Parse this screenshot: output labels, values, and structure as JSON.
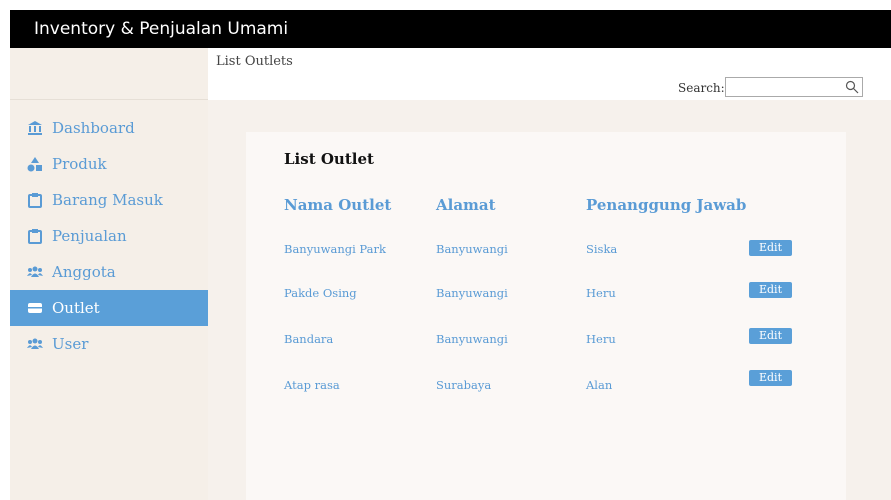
{
  "app": {
    "title": "Inventory & Penjualan Umami"
  },
  "sidebar": {
    "items": [
      {
        "label": "Dashboard",
        "icon": "bank-icon",
        "active": false
      },
      {
        "label": "Produk",
        "icon": "shapes-icon",
        "active": false
      },
      {
        "label": "Barang Masuk",
        "icon": "clipboard-icon",
        "active": false
      },
      {
        "label": "Penjualan",
        "icon": "clipboard-icon",
        "active": false
      },
      {
        "label": "Anggota",
        "icon": "users-icon",
        "active": false
      },
      {
        "label": "Outlet",
        "icon": "store-icon",
        "active": true
      },
      {
        "label": "User",
        "icon": "users-icon",
        "active": false
      }
    ]
  },
  "header": {
    "breadcrumb": "List Outlets",
    "search_label": "Search:",
    "search_value": ""
  },
  "table": {
    "title": "List Outlet",
    "columns": [
      "Nama Outlet",
      "Alamat",
      "Penanggung Jawab"
    ],
    "rows": [
      {
        "nama": "Banyuwangi Park",
        "alamat": "Banyuwangi",
        "pj": "Siska",
        "action": "Edit"
      },
      {
        "nama": "Pakde Osing",
        "alamat": "Banyuwangi",
        "pj": "Heru",
        "action": "Edit"
      },
      {
        "nama": "Bandara",
        "alamat": "Banyuwangi",
        "pj": "Heru",
        "action": "Edit"
      },
      {
        "nama": "Atap rasa",
        "alamat": "Surabaya",
        "pj": "Alan",
        "action": "Edit"
      }
    ]
  },
  "colors": {
    "accent": "#5a9fd8",
    "topbar": "#000000",
    "sidebar_bg": "#f5efe8"
  }
}
